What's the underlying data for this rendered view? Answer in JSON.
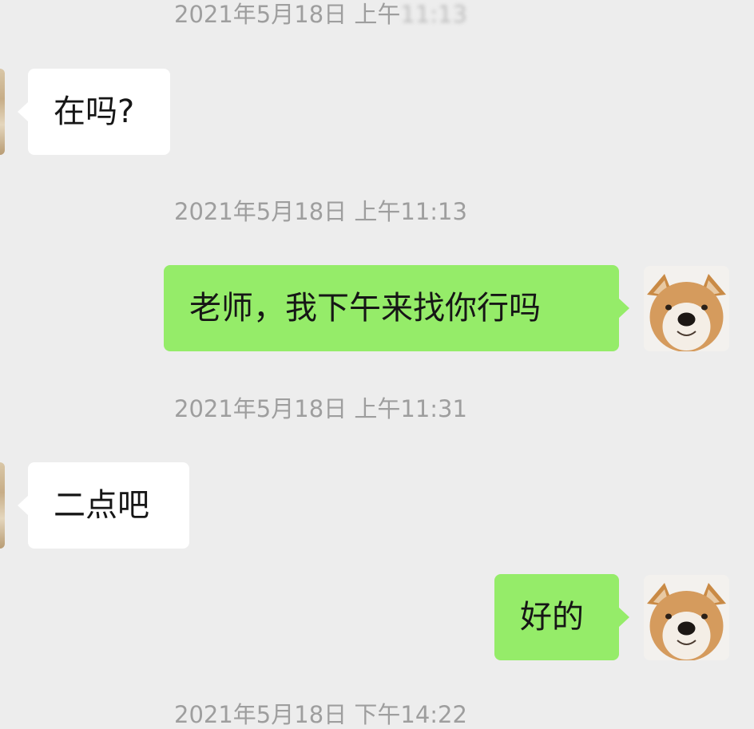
{
  "timestamps": [
    {
      "visible": "2021年5月18日 上午",
      "blurred": "11:13"
    },
    {
      "visible": "2021年5月18日 上午11:13",
      "blurred": ""
    },
    {
      "visible": "2021年5月18日 上午11:31",
      "blurred": ""
    },
    {
      "visible": "2021年5月18日 下午14:22",
      "blurred": ""
    }
  ],
  "messages": [
    {
      "side": "left",
      "text": "在吗?"
    },
    {
      "side": "right",
      "text": "老师，我下午来找你行吗"
    },
    {
      "side": "left",
      "text": "二点吧"
    },
    {
      "side": "right",
      "text": "好的"
    }
  ],
  "colors": {
    "background": "#ededed",
    "incoming_bubble": "#ffffff",
    "outgoing_bubble": "#95ec69",
    "timestamp_text": "#9e9e9e",
    "message_text": "#161616"
  },
  "icons": {
    "sender_avatar": "shiba-inu-dog-avatar-icon",
    "contact_avatar": "cropped-avatar-icon"
  }
}
